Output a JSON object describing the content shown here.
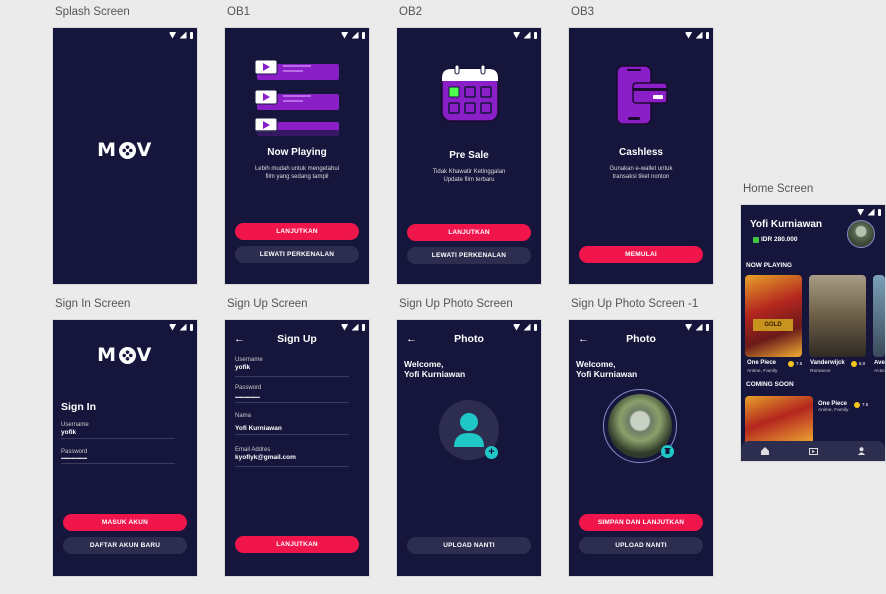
{
  "labels": {
    "splash": "Splash Screen",
    "ob1": "OB1",
    "ob2": "OB2",
    "ob3": "OB3",
    "home": "Home Screen",
    "signin": "Sign In Screen",
    "signup": "Sign Up Screen",
    "signup_photo": "Sign Up Photo Screen",
    "signup_photo_1": "Sign Up Photo Screen -1"
  },
  "logo": {
    "pre": "M",
    "post": "V"
  },
  "ob1": {
    "title": "Now Playing",
    "desc1": "Lebih mudah untuk mengetahui",
    "desc2": "film yang sedang tampil",
    "btn1": "LANJUTKAN",
    "btn2": "LEWATI  PERKENALAN"
  },
  "ob2": {
    "title": "Pre Sale",
    "desc1": "Tidak Khawatir Ketinggalan",
    "desc2": "Update film terbaru",
    "btn1": "LANJUTKAN",
    "btn2": "LEWATI  PERKENALAN"
  },
  "ob3": {
    "title": "Cashless",
    "desc1": "Gunakan e-wallet untuk",
    "desc2": "transaksi tiket nonton",
    "btn1": "MEMULAI"
  },
  "signin": {
    "title": "Sign In",
    "username_label": "Username",
    "username_value": "yofik",
    "password_label": "Password",
    "password_value": "••••••••••••••••••••••",
    "btn1": "MASUK AKUN",
    "btn2": "DAFTAR AKUN BARU"
  },
  "signup": {
    "title": "Sign Up",
    "username_label": "Username",
    "username_value": "yofik",
    "password_label": "Password",
    "password_value": "•••••••••••••••••••••",
    "name_label": "Nama",
    "name_value": "Yofi Kurniawan",
    "email_label": "Email Addres",
    "email_value": "kyofiyk@gmail.com",
    "btn1": "LANJUTKAN"
  },
  "photo": {
    "title": "Photo",
    "welcome1": "Welcome,",
    "welcome2": "Yofi Kurniawan",
    "btn": "UPLOAD NANTI",
    "btn_save": "SIMPAN DAN LANJUTKAN"
  },
  "home": {
    "name": "Yofi Kurniawan",
    "balance": "IDR 280.000",
    "now_playing": "NOW PLAYING",
    "coming_soon": "COMING SOON",
    "movies": [
      {
        "title": "One Piece",
        "genre": "Anime, Family",
        "rating": "7.5"
      },
      {
        "title": "Vanderwijck",
        "genre": "Romance",
        "rating": "8.0"
      },
      {
        "title": "Ave",
        "genre": "Actio"
      }
    ],
    "coming": {
      "title": "One Piece",
      "genre": "Anime, Family",
      "rating": "7.5"
    }
  },
  "icons": [
    "wifi-icon",
    "signal-icon",
    "battery-icon",
    "play-icon",
    "calendar-icon",
    "wallet-icon",
    "back-arrow-icon",
    "user-icon",
    "add-icon",
    "delete-icon",
    "home-icon",
    "ticket-icon",
    "profile-icon",
    "star-icon"
  ],
  "colors": {
    "background": "#16153c",
    "accent": "#f0154b",
    "purple": "#8a1fc7",
    "secondary_button": "#2d2d50",
    "teal": "#1fc7c7"
  }
}
